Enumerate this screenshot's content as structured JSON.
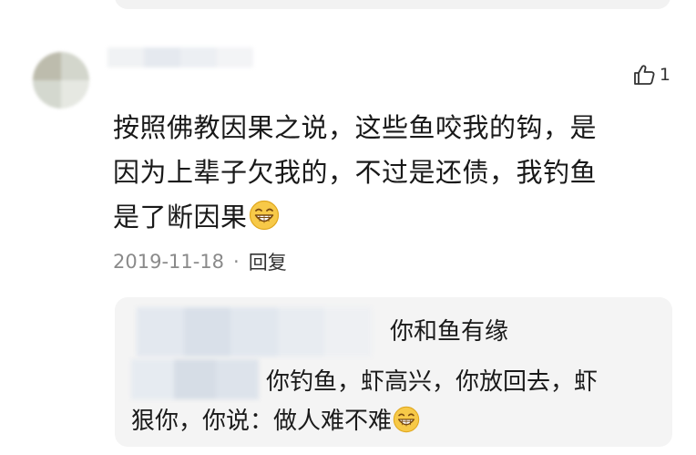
{
  "prev_comment": {},
  "comment": {
    "like_icon": "thumbs-up-icon",
    "like_count": "1",
    "text_lines": [
      "按照佛教因果之说，这些鱼咬我的钩，是",
      "因为上辈子欠我的，不过是还债，我钓鱼",
      "是了断因果"
    ],
    "emoji": "grinning-face-emoji",
    "date": "2019-11-18",
    "separator": "·",
    "reply_label": "回复"
  },
  "reply": {
    "line1": "你和鱼有缘",
    "line2": "你钓鱼，虾高兴，你放回去，虾",
    "line3": "狠你，你说：做人难不难",
    "emoji": "grinning-face-emoji"
  },
  "colors": {
    "reply_bg": "#f4f4f4",
    "meta_text": "#8a8a8a",
    "emoji_yellow": "#f7c948"
  }
}
